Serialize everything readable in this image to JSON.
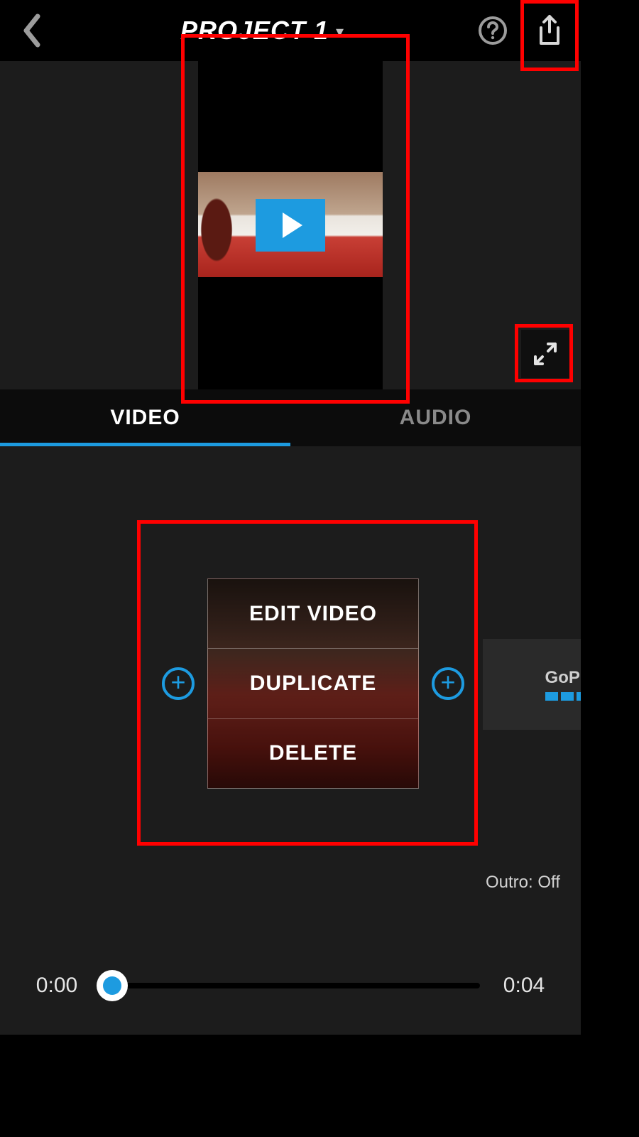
{
  "header": {
    "title": "PROJECT 1"
  },
  "tabs": {
    "video": "VIDEO",
    "audio": "AUDIO",
    "active": "video"
  },
  "clip_menu": {
    "edit": "EDIT VIDEO",
    "duplicate": "DUPLICATE",
    "delete": "DELETE"
  },
  "outro": {
    "brand": "GoPro",
    "label": "Outro: Off"
  },
  "scrubber": {
    "current": "0:00",
    "total": "0:04"
  }
}
